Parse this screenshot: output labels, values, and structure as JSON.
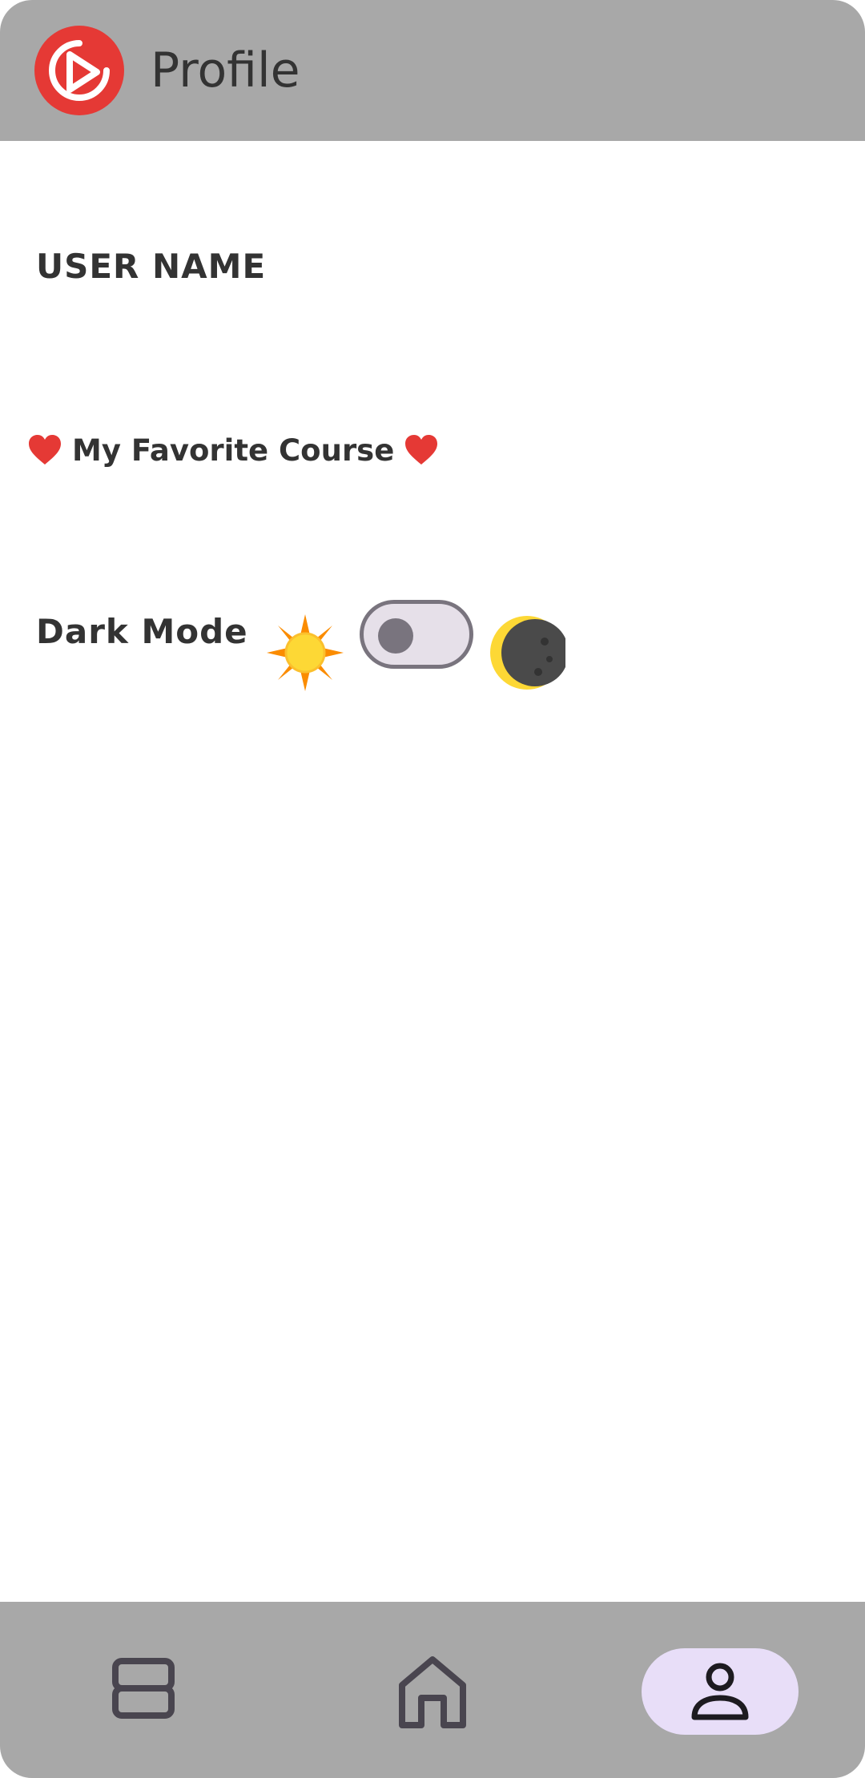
{
  "header": {
    "title": "Profile",
    "logo_icon": "play-logo-icon",
    "background": "#a8a8a8",
    "logo_color": "#e53935"
  },
  "profile": {
    "user_name": "USER NAME",
    "favorite_course_label": "My Favorite Course",
    "favorite_icon": "heart-icon"
  },
  "settings": {
    "dark_mode_label": "Dark Mode",
    "dark_mode_on": false,
    "light_icon": "sun-icon",
    "dark_icon": "moon-icon"
  },
  "bottom_nav": {
    "items": [
      {
        "icon": "courses-icon",
        "active": false
      },
      {
        "icon": "home-icon",
        "active": false
      },
      {
        "icon": "person-icon",
        "active": true
      }
    ],
    "active_color": "#e8def8"
  }
}
